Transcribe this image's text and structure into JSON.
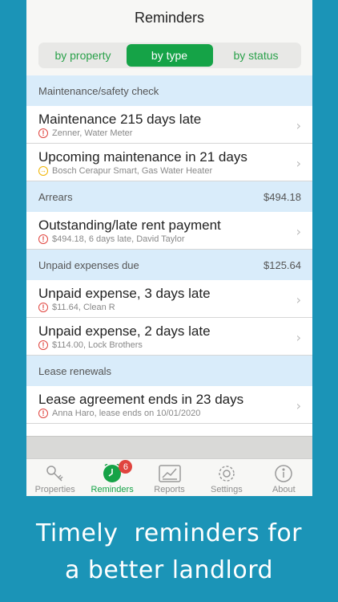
{
  "nav": {
    "title": "Reminders"
  },
  "segments": [
    {
      "label": "by property",
      "active": false
    },
    {
      "label": "by type",
      "active": true
    },
    {
      "label": "by status",
      "active": false
    }
  ],
  "sections": [
    {
      "title": "Maintenance/safety check",
      "amount": "",
      "rows": [
        {
          "title": "Maintenance 215 days late",
          "subtitle": "Zenner, Water Meter",
          "status": "late"
        },
        {
          "title": "Upcoming maintenance in 21 days",
          "subtitle": "Bosch Cerapur Smart, Gas Water Heater",
          "status": "upcoming"
        }
      ]
    },
    {
      "title": "Arrears",
      "amount": "$494.18",
      "rows": [
        {
          "title": "Outstanding/late rent payment",
          "subtitle": "$494.18, 6 days late, David Taylor",
          "status": "late"
        }
      ]
    },
    {
      "title": "Unpaid expenses due",
      "amount": "$125.64",
      "rows": [
        {
          "title": "Unpaid expense, 3 days late",
          "subtitle": "$11.64, Clean R",
          "status": "late"
        },
        {
          "title": "Unpaid expense, 2 days late",
          "subtitle": "$114.00, Lock Brothers",
          "status": "late"
        }
      ]
    },
    {
      "title": "Lease renewals",
      "amount": "",
      "rows": [
        {
          "title": "Lease agreement ends in 23 days",
          "subtitle": "Anna Haro, lease ends on 10/01/2020",
          "status": "late"
        }
      ]
    }
  ],
  "tabs": [
    {
      "label": "Properties",
      "icon": "key-icon",
      "active": false,
      "badge": ""
    },
    {
      "label": "Reminders",
      "icon": "clock-icon",
      "active": true,
      "badge": "6"
    },
    {
      "label": "Reports",
      "icon": "chart-icon",
      "active": false,
      "badge": ""
    },
    {
      "label": "Settings",
      "icon": "gear-icon",
      "active": false,
      "badge": ""
    },
    {
      "label": "About",
      "icon": "info-icon",
      "active": false,
      "badge": ""
    }
  ],
  "caption": {
    "line1": "Timely  reminders for",
    "line2": "a better landlord"
  },
  "colors": {
    "accent": "#15a347",
    "background": "#1b94b7",
    "section": "#d9ecfa",
    "alert": "#e0443e",
    "warning": "#f0b400"
  }
}
